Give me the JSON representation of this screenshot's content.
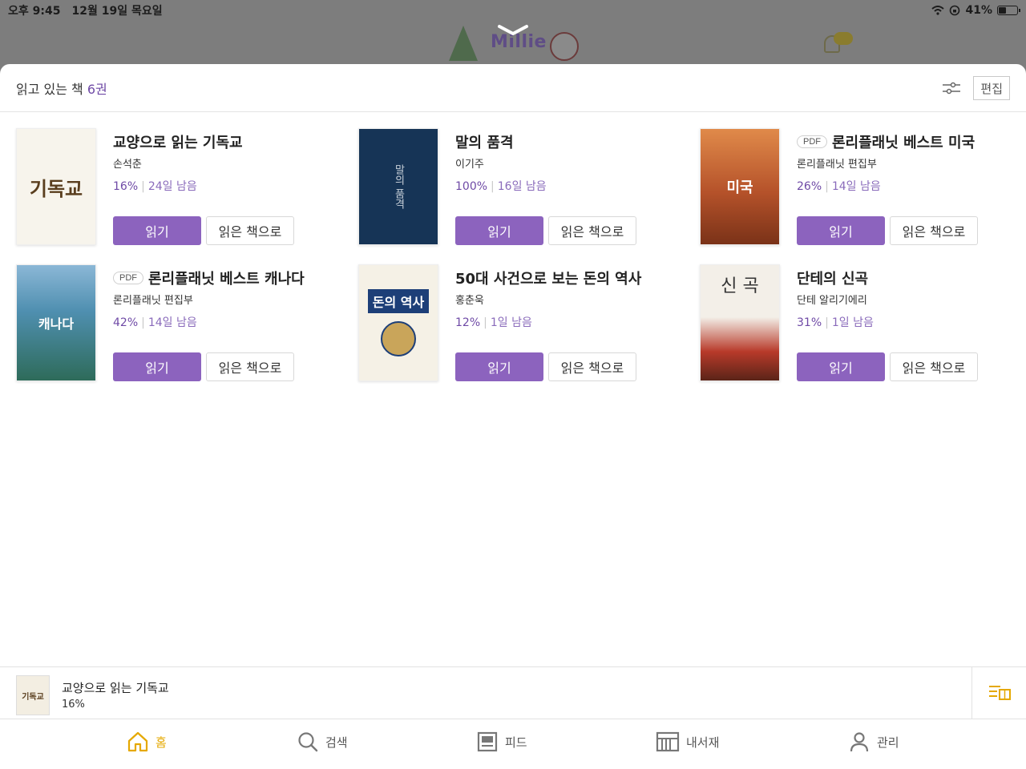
{
  "status": {
    "time": "오후 9:45",
    "date": "12월 19일 목요일",
    "battery": "41%"
  },
  "background": {
    "logo": "Millie"
  },
  "sheet": {
    "title_prefix": "읽고 있는 책",
    "count": "6권",
    "edit_label": "편집"
  },
  "labels": {
    "read": "읽기",
    "mark_done": "읽은 책으로",
    "pdf": "PDF"
  },
  "books": [
    {
      "title": "교양으로 읽는 기독교",
      "author": "손석춘",
      "progress": "16%",
      "remaining": "24일 남음",
      "pdf": false,
      "cover_color": "#f7f4ec",
      "cover_text": "기독교",
      "cover_text_color": "#5a3e1e"
    },
    {
      "title": "말의 품격",
      "author": "이기주",
      "progress": "100%",
      "remaining": "16일 남음",
      "pdf": false,
      "cover_color": "#163456",
      "cover_text": "말의 품격",
      "cover_text_color": "#c7cfd8"
    },
    {
      "title": "론리플래닛 베스트 미국",
      "author": "론리플래닛 편집부",
      "progress": "26%",
      "remaining": "14일 남음",
      "pdf": true,
      "cover_color": "#b5522a",
      "cover_text": "미국",
      "cover_text_color": "#ffffff"
    },
    {
      "title": "론리플래닛 베스트 캐나다",
      "author": "론리플래닛 편집부",
      "progress": "42%",
      "remaining": "14일 남음",
      "pdf": true,
      "cover_color": "#4f8fb0",
      "cover_text": "캐나다",
      "cover_text_color": "#ffffff"
    },
    {
      "title": "50대 사건으로 보는 돈의 역사",
      "author": "홍춘욱",
      "progress": "12%",
      "remaining": "1일 남음",
      "pdf": false,
      "cover_color": "#f5f1e6",
      "cover_text": "돈의 역사",
      "cover_text_color": "#1d3f78"
    },
    {
      "title": "단테의 신곡",
      "author": "단테 알리기에리",
      "progress": "31%",
      "remaining": "1일 남음",
      "pdf": false,
      "cover_color": "#f3efe8",
      "cover_text": "신 곡",
      "cover_text_color": "#333333"
    }
  ],
  "now_reading": {
    "title": "교양으로 읽는 기독교",
    "progress": "16%"
  },
  "tabs": [
    {
      "label": "홈",
      "icon": "home-icon",
      "active": true
    },
    {
      "label": "검색",
      "icon": "search-icon",
      "active": false
    },
    {
      "label": "피드",
      "icon": "feed-icon",
      "active": false
    },
    {
      "label": "내서재",
      "icon": "library-icon",
      "active": false
    },
    {
      "label": "관리",
      "icon": "profile-icon",
      "active": false
    }
  ],
  "colors": {
    "accent": "#8c63be",
    "tab_active": "#e5a800"
  }
}
